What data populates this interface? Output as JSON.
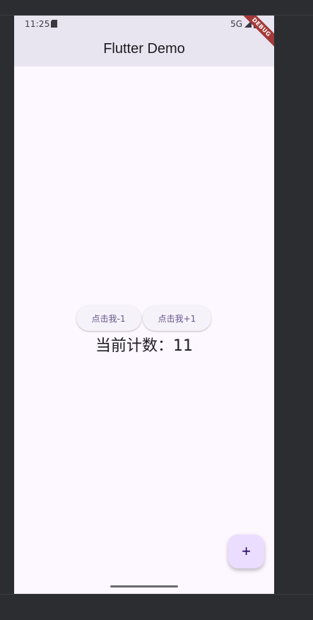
{
  "status_bar": {
    "time": "11:25",
    "network": "5G"
  },
  "app_bar": {
    "title": "Flutter Demo"
  },
  "debug_banner": {
    "label": "DEBUG"
  },
  "buttons": {
    "decrement_label": "点击我-1",
    "increment_label": "点击我+1"
  },
  "counter": {
    "text": "当前计数：11"
  },
  "fab": {
    "icon": "add-icon",
    "glyph": "+"
  },
  "colors": {
    "background": "#fdf7ff",
    "app_bar": "#e8e4f0",
    "button_text": "#65558f",
    "fab": "#eaddff",
    "debug_ribbon": "#a33a3a"
  }
}
